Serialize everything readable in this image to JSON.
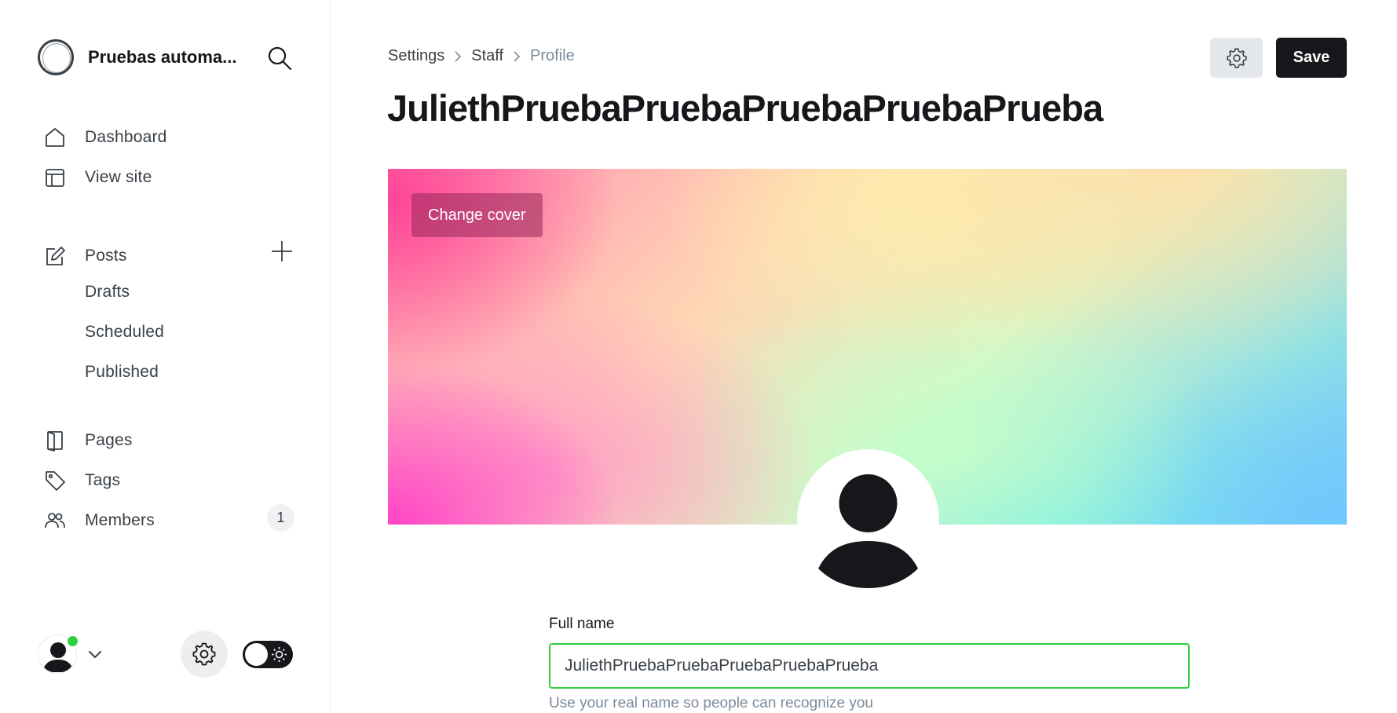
{
  "sidebar": {
    "brand_name": "Pruebas automa...",
    "nav": {
      "dashboard": "Dashboard",
      "view_site": "View site",
      "posts": "Posts",
      "drafts": "Drafts",
      "scheduled": "Scheduled",
      "published": "Published",
      "pages": "Pages",
      "tags": "Tags",
      "members": "Members",
      "members_count": "1"
    }
  },
  "header": {
    "breadcrumb": [
      "Settings",
      "Staff",
      "Profile"
    ],
    "title": "JuliethPruebaPruebaPruebaPruebaPrueba",
    "save_label": "Save"
  },
  "cover": {
    "change_cover_label": "Change cover"
  },
  "form": {
    "full_name_label": "Full name",
    "full_name_value": "JuliethPruebaPruebaPruebaPruebaPrueba",
    "full_name_hint": "Use your real name so people can recognize you"
  },
  "colors": {
    "accent_green": "#30cf43",
    "primary_dark": "#15171a",
    "muted_text": "#7c8b9a"
  },
  "icons": {
    "search": "search-icon",
    "settings": "gear-icon",
    "add_post": "plus-icon",
    "theme": "sun-icon"
  }
}
